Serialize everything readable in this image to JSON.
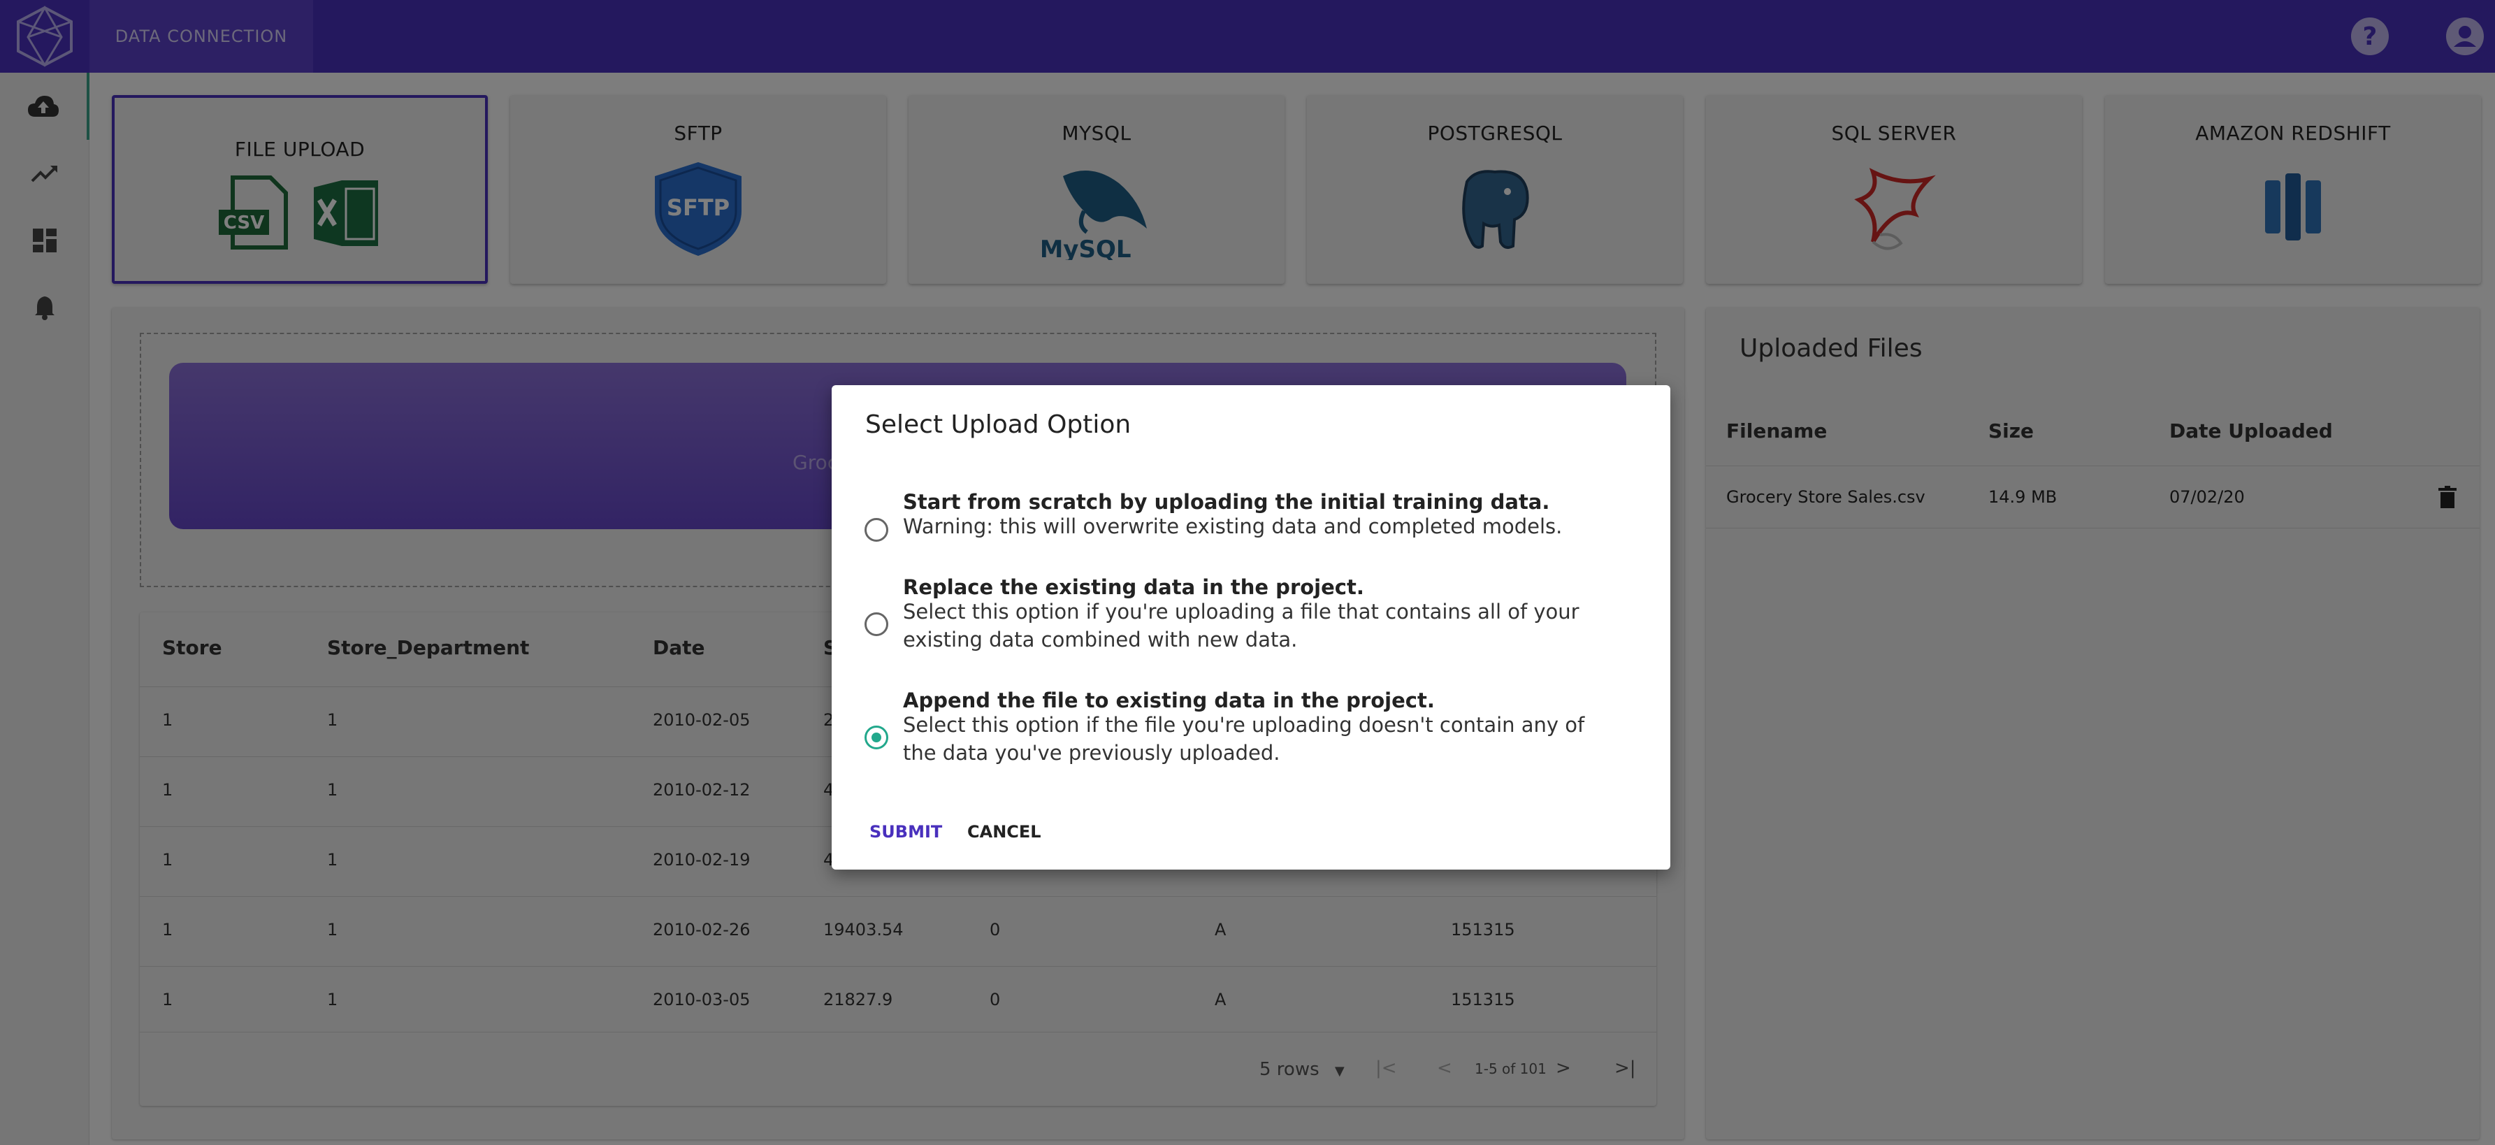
{
  "app": {
    "section_title": "DATA CONNECTION"
  },
  "sources": [
    {
      "label": "FILE UPLOAD",
      "icon": "csv-excel-icon",
      "selected": true
    },
    {
      "label": "SFTP",
      "icon": "sftp-shield-icon"
    },
    {
      "label": "MYSQL",
      "icon": "mysql-dolphin-icon"
    },
    {
      "label": "POSTGRESQL",
      "icon": "postgresql-elephant-icon"
    },
    {
      "label": "SQL SERVER",
      "icon": "sql-server-icon"
    },
    {
      "label": "AMAZON REDSHIFT",
      "icon": "amazon-redshift-icon"
    }
  ],
  "source_icon_text": {
    "csv": "CSV",
    "sftp": "SFTP",
    "mysql": "MySQL"
  },
  "upload": {
    "dropzone_text": "Groc"
  },
  "table": {
    "headers": [
      "Store",
      "Store_Department",
      "Date",
      "S"
    ],
    "rows": [
      [
        "1",
        "1",
        "2010-02-05",
        "2",
        "",
        "",
        ""
      ],
      [
        "1",
        "1",
        "2010-02-12",
        "4",
        "",
        "",
        ""
      ],
      [
        "1",
        "1",
        "2010-02-19",
        "4",
        "",
        "",
        ""
      ],
      [
        "1",
        "1",
        "2010-02-26",
        "19403.54",
        "0",
        "A",
        "151315"
      ],
      [
        "1",
        "1",
        "2010-03-05",
        "21827.9",
        "0",
        "A",
        "151315"
      ]
    ],
    "pager": {
      "rows_per_page": "5 rows",
      "range": "1-5 of 101"
    }
  },
  "uploaded_files": {
    "title": "Uploaded Files",
    "headers": [
      "Filename",
      "Size",
      "Date Uploaded"
    ],
    "rows": [
      {
        "filename": "Grocery Store Sales.csv",
        "size": "14.9 MB",
        "date": "07/02/20"
      }
    ]
  },
  "dialog": {
    "title": "Select Upload Option",
    "options": [
      {
        "title": "Start from scratch by uploading the initial training data.",
        "text": "Warning: this will overwrite existing data and completed models.",
        "selected": false
      },
      {
        "title": "Replace the existing data in the project.",
        "text": "Select this option if you're uploading a file that contains all of your existing data combined with new data.",
        "selected": false
      },
      {
        "title": "Append the file to existing data in the project.",
        "text": "Select this option if the file you're uploading doesn't contain any of the data you've previously uploaded.",
        "selected": true
      }
    ],
    "submit": "SUBMIT",
    "cancel": "CANCEL"
  },
  "colors": {
    "brand": "#4930bd",
    "accent": "#22a88c"
  },
  "icons": {
    "help": "?"
  }
}
